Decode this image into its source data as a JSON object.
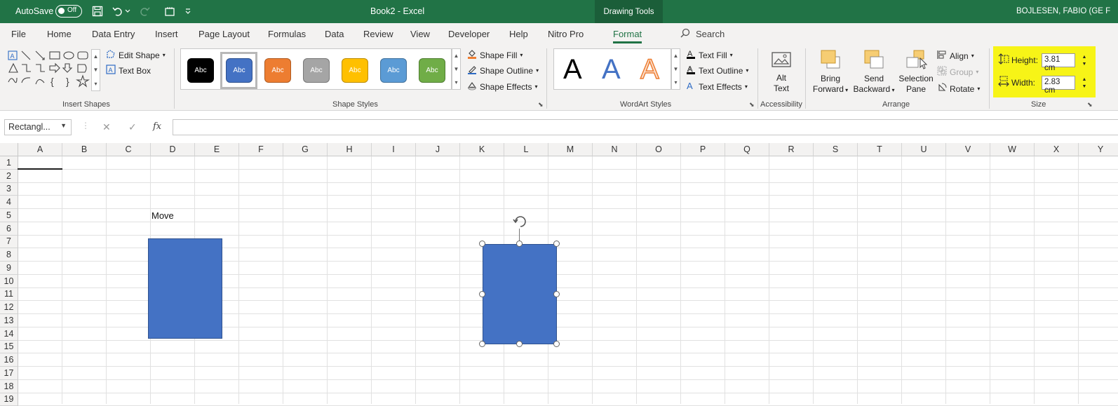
{
  "titlebar": {
    "autosave_label": "AutoSave",
    "autosave_state": "Off",
    "doc_title": "Book2  -  Excel",
    "context_tab": "Drawing Tools",
    "user": "BOJLESEN, FABIO (GE F",
    "bg_color": "#217346"
  },
  "tabs": [
    "File",
    "Home",
    "Data Entry",
    "Insert",
    "Page Layout",
    "Formulas",
    "Data",
    "Review",
    "View",
    "Developer",
    "Help",
    "Nitro Pro",
    "Format"
  ],
  "active_tab": "Format",
  "search_label": "Search",
  "ribbon": {
    "insert_shapes": {
      "edit_shape": "Edit Shape",
      "text_box": "Text Box",
      "label": "Insert Shapes"
    },
    "shape_styles": {
      "swatches": [
        {
          "label": "Abc",
          "color": "#000000"
        },
        {
          "label": "Abc",
          "color": "#4472c4"
        },
        {
          "label": "Abc",
          "color": "#ed7d31"
        },
        {
          "label": "Abc",
          "color": "#a5a5a5"
        },
        {
          "label": "Abc",
          "color": "#ffc000"
        },
        {
          "label": "Abc",
          "color": "#5b9bd5"
        },
        {
          "label": "Abc",
          "color": "#70ad47"
        }
      ],
      "shape_fill": "Shape Fill",
      "shape_outline": "Shape Outline",
      "shape_effects": "Shape Effects",
      "label": "Shape Styles"
    },
    "wordart": {
      "text_fill": "Text Fill",
      "text_outline": "Text Outline",
      "text_effects": "Text Effects",
      "label": "WordArt Styles",
      "sample": "A"
    },
    "accessibility": {
      "alt_text_1": "Alt",
      "alt_text_2": "Text",
      "label": "Accessibility"
    },
    "arrange": {
      "bring_1": "Bring",
      "bring_2": "Forward",
      "send_1": "Send",
      "send_2": "Backward",
      "sel_1": "Selection",
      "sel_2": "Pane",
      "align": "Align",
      "group": "Group",
      "rotate": "Rotate",
      "label": "Arrange"
    },
    "size": {
      "height_label": "Height:",
      "height_value": "3.81 cm",
      "width_label": "Width:",
      "width_value": "2.83 cm",
      "label": "Size",
      "highlight_color": "#f7f417"
    }
  },
  "formula_bar": {
    "name_box": "Rectangl...",
    "cancel": "✕",
    "enter": "✓",
    "fx": "fx"
  },
  "columns": [
    "A",
    "B",
    "C",
    "D",
    "E",
    "F",
    "G",
    "H",
    "I",
    "J",
    "K",
    "L",
    "M",
    "N",
    "O",
    "P",
    "Q",
    "R",
    "S",
    "T",
    "U",
    "V",
    "W",
    "X",
    "Y"
  ],
  "rows": [
    "1",
    "2",
    "3",
    "4",
    "5",
    "6",
    "7",
    "8",
    "9",
    "10",
    "11",
    "12",
    "13",
    "14",
    "15",
    "16",
    "17",
    "18",
    "19"
  ],
  "cells": {
    "D5": "Move"
  },
  "shape_color": "#4472c4"
}
